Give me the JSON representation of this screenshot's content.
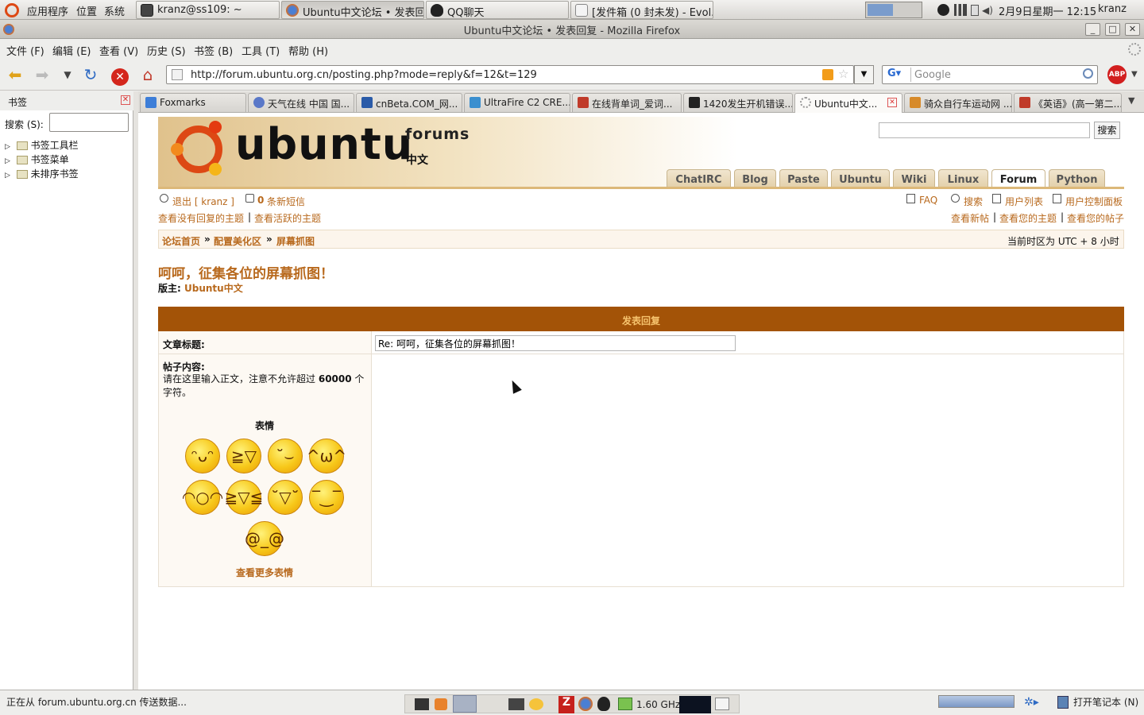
{
  "panel": {
    "menus": [
      "应用程序",
      "位置",
      "系统"
    ],
    "tasks": [
      "kranz@ss109: ~",
      "Ubuntu中文论坛 • 发表回...",
      "QQ聊天",
      "[发件箱 (0 封未发) - Evol..."
    ],
    "clock": "2月9日星期一 12:15",
    "user": "kranz"
  },
  "window": {
    "title": "Ubuntu中文论坛 • 发表回复 - Mozilla Firefox"
  },
  "menubar": [
    "文件 (F)",
    "编辑 (E)",
    "查看 (V)",
    "历史 (S)",
    "书签 (B)",
    "工具 (T)",
    "帮助 (H)"
  ],
  "navbar": {
    "url": "http://forum.ubuntu.org.cn/posting.php?mode=reply&f=12&t=129",
    "search_placeholder": "Google",
    "abp": "ABP"
  },
  "sidebar": {
    "title": "书签",
    "search_label": "搜索 (S):",
    "items": [
      "书签工具栏",
      "书签菜单",
      "未排序书签"
    ]
  },
  "tabs": [
    "Foxmarks",
    "天气在线 中国 国...",
    "cnBeta.COM_网...",
    "UltraFire C2 CRE...",
    "在线背单词_爱词...",
    "1420发生开机错误...",
    "Ubuntu中文...",
    "骑众自行车运动网 ...",
    "《英语》(高一第二..."
  ],
  "page": {
    "logo_word": "ubuntu",
    "logo_forums": "forums",
    "logo_cn": "中文",
    "search_button": "搜索",
    "nav_tabs": [
      "ChatIRC",
      "Blog",
      "Paste",
      "Ubuntu",
      "Wiki",
      "Linux",
      "Forum",
      "Python"
    ],
    "logout": "退出 [ kranz ]",
    "pm_count": "0",
    "pm_label": "条新短信",
    "unanswered": "查看没有回复的主题",
    "active": "查看活跃的主题",
    "faq": "FAQ",
    "search": "搜索",
    "memberlist": "用户列表",
    "ucp": "用户控制面板",
    "new_posts": "查看新帖",
    "your_topics": "查看您的主题",
    "your_posts": "查看您的帖子",
    "crumbs": [
      "论坛首页",
      "配置美化区",
      "屏幕抓图"
    ],
    "timezone": "当前时区为 UTC + 8 小时",
    "topic_title": "呵呵，征集各位的屏幕抓图！",
    "moderator_label": "版主:",
    "moderator": "Ubuntu中文",
    "form_header": "发表回复",
    "subject_label": "文章标题:",
    "subject_value": "Re: 呵呵，征集各位的屏幕抓图！",
    "body_label": "帖子内容:",
    "body_hint_pre": "请在这里输入正文，注意不允许超过",
    "body_hint_num": "60000",
    "body_hint_post": "个字符。",
    "smilies_label": "表情",
    "more_smilies": "查看更多表情"
  },
  "statusbar": {
    "text": "正在从 forum.ubuntu.org.cn 传送数据...",
    "cpu": "1.60 GHz",
    "notes": "打开笔记本 (N)"
  },
  "colors": {
    "accent": "#a35307",
    "link": "#b8691d",
    "ubuntu_orange": "#dd4814"
  }
}
